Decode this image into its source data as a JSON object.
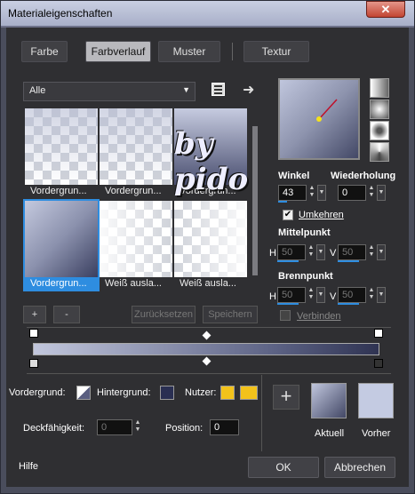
{
  "window": {
    "title": "Materialeigenschaften",
    "close": "✕"
  },
  "tabs": [
    {
      "label": "Farbe"
    },
    {
      "label": "Farbverlauf"
    },
    {
      "label": "Muster"
    },
    {
      "label": "Textur"
    }
  ],
  "gallery": {
    "category": "Alle",
    "items": [
      {
        "label": "Vordergrun..."
      },
      {
        "label": "Vordergrun..."
      },
      {
        "label": "Vordergrun..."
      },
      {
        "label": "Vordergrun..."
      },
      {
        "label": "Weiß ausla..."
      },
      {
        "label": "Weiß ausla..."
      }
    ],
    "watermark": "by pido"
  },
  "buttons": {
    "add": "+",
    "remove": "-",
    "reset": "Zurücksetzen",
    "save": "Speichern",
    "ok": "OK",
    "cancel": "Abbrechen",
    "help": "Hilfe",
    "plus": "+"
  },
  "angle": {
    "label": "Winkel",
    "value": "43"
  },
  "repeat": {
    "label": "Wiederholung",
    "value": "0"
  },
  "invert": {
    "label": "Umkehren",
    "checked": true
  },
  "center": {
    "label": "Mittelpunkt",
    "h_label": "H",
    "h": "50",
    "v_label": "V",
    "v": "50"
  },
  "focus": {
    "label": "Brennpunkt",
    "h_label": "H",
    "h": "50",
    "v_label": "V",
    "v": "50"
  },
  "link": {
    "label": "Verbinden",
    "checked": false
  },
  "bottom": {
    "fg_label": "Vordergrund:",
    "bg_label": "Hintergrund:",
    "user_label": "Nutzer:",
    "opacity_label": "Deckfähigkeit:",
    "opacity": "0",
    "position_label": "Position:",
    "position": "0",
    "current_label": "Aktuell",
    "previous_label": "Vorher"
  },
  "colors": {
    "accent": "#2e8de0",
    "user": "#f2c21b",
    "current_top": "#c0c6dd",
    "current_bottom": "#434866",
    "previous": "#c4cbe2"
  }
}
